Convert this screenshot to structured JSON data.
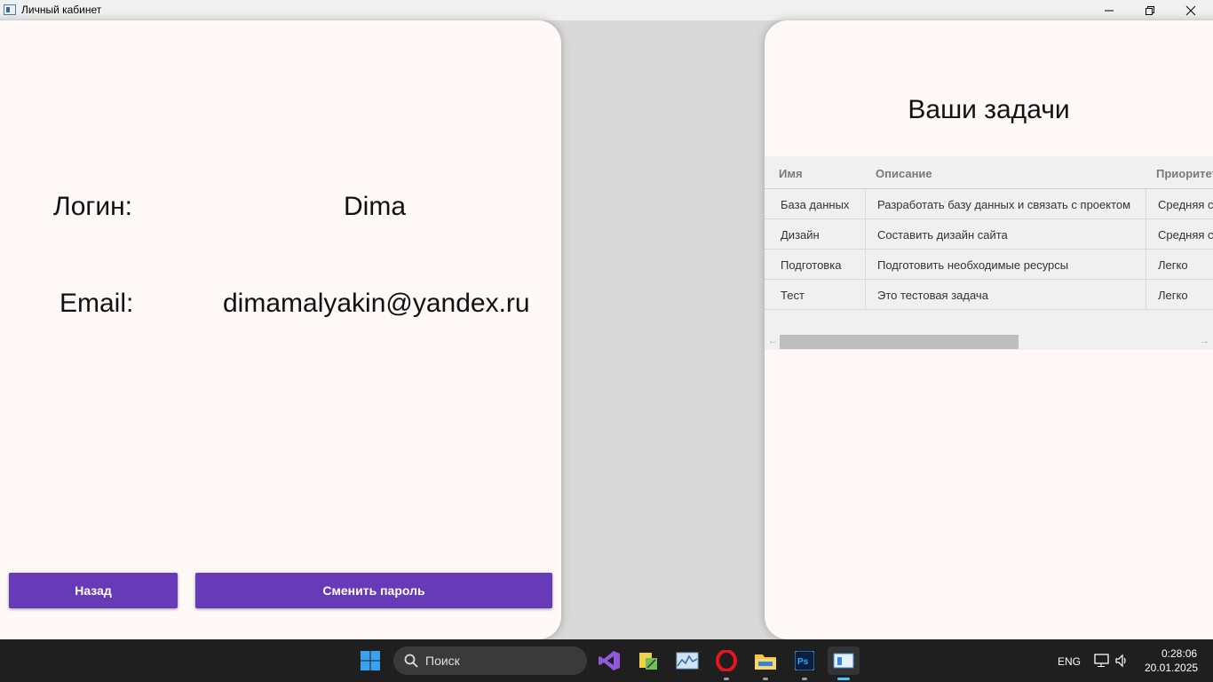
{
  "window": {
    "title": "Личный кабинет"
  },
  "profile": {
    "login_label": "Логин:",
    "login_value": "Dima",
    "email_label": "Email:",
    "email_value": "dimamalyakin@yandex.ru"
  },
  "buttons": {
    "back": "Назад",
    "change_password": "Сменить пароль"
  },
  "tasks": {
    "title": "Ваши задачи",
    "columns": [
      "Имя",
      "Описание",
      "Приоритет"
    ],
    "rows": [
      {
        "name": "База данных",
        "description": "Разработать базу данных и связать с проектом",
        "priority": "Средняя сл"
      },
      {
        "name": "Дизайн",
        "description": "Составить дизайн сайта",
        "priority": "Средняя сл"
      },
      {
        "name": "Подготовка",
        "description": "Подготовить необходимые ресурсы",
        "priority": "Легко"
      },
      {
        "name": "Тест",
        "description": "Это тестовая задача",
        "priority": "Легко"
      }
    ]
  },
  "taskbar": {
    "search_placeholder": "Поиск",
    "language": "ENG",
    "time": "0:28:06",
    "date": "20.01.2025",
    "accent": "#673ab7"
  }
}
